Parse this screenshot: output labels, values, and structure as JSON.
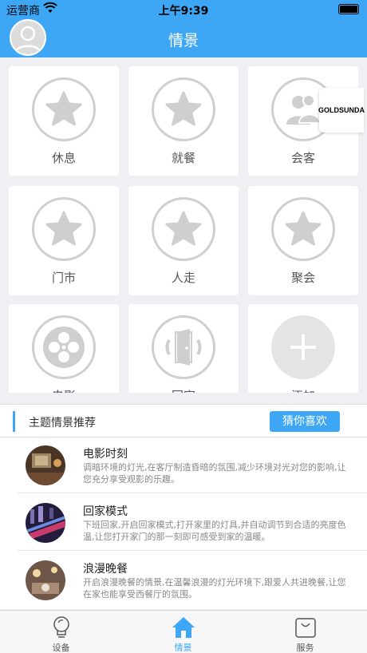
{
  "status_bar": {
    "carrier": "运营商",
    "time": "上午9:39"
  },
  "nav": {
    "title": "情景"
  },
  "scenes": [
    {
      "label": "休息",
      "icon": "star-icon"
    },
    {
      "label": "就餐",
      "icon": "star-icon"
    },
    {
      "label": "会客",
      "icon": "people-icon"
    },
    {
      "label": "门市",
      "icon": "star-icon"
    },
    {
      "label": "人走",
      "icon": "star-icon"
    },
    {
      "label": "聚会",
      "icon": "star-icon"
    },
    {
      "label": "电影",
      "icon": "film-reel-icon"
    },
    {
      "label": "回家",
      "icon": "door-icon"
    },
    {
      "label": "添加",
      "icon": "plus-icon"
    }
  ],
  "overlay_logo_text": "GOLDSUNDA",
  "recommend": {
    "title": "主题情景推荐",
    "guess_button": "猜你喜欢"
  },
  "themes": [
    {
      "name": "电影时刻",
      "desc": "调暗环境的灯光,在客厅制造昏暗的氛围,减少环境对光对您的影响,让您充分享受观影的乐趣。"
    },
    {
      "name": "回家模式",
      "desc": "下班回家,开启回家模式,打开家里的灯具,并自动调节到合适的亮度色温,让您打开家门的那一刻即可感受到家的温暖。"
    },
    {
      "name": "浪漫晚餐",
      "desc": "开启浪漫晚餐的情景,在温馨浪漫的灯光环境下,跟爱人共进晚餐,让您在家也能享受西餐厅的氛围。"
    }
  ],
  "tabs": [
    {
      "label": "设备",
      "icon": "bulb-icon"
    },
    {
      "label": "情景",
      "icon": "home-icon"
    },
    {
      "label": "服务",
      "icon": "bag-icon"
    }
  ],
  "colors": {
    "accent": "#3ea7f5",
    "icon_gray": "#cfcfcf"
  }
}
